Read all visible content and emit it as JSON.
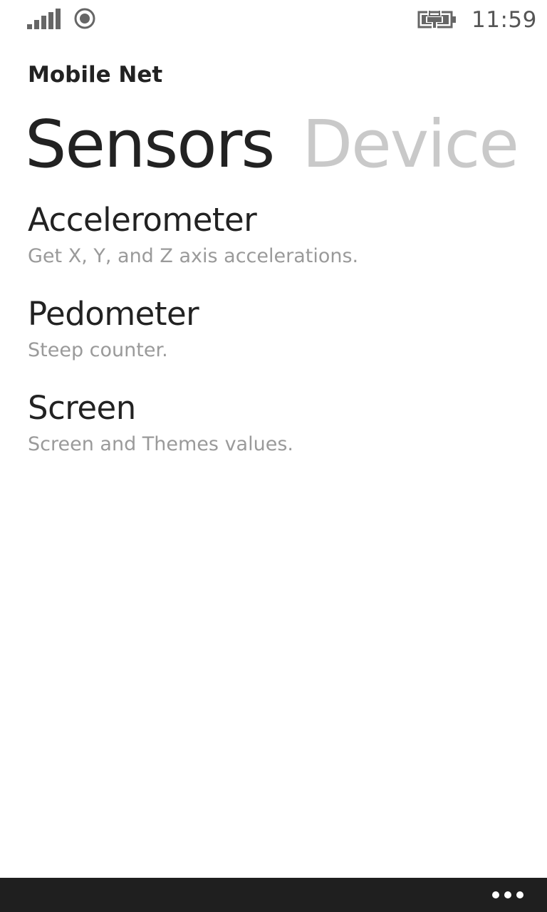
{
  "status_bar": {
    "time": "11:59",
    "signal_icon": "signal-strength-icon",
    "data_icon": "data-connection-icon",
    "battery_icon": "battery-charging-icon"
  },
  "app": {
    "title": "Mobile Net"
  },
  "pivot": {
    "active": "Sensors",
    "next": "Device"
  },
  "list": [
    {
      "title": "Accelerometer",
      "subtitle": "Get X, Y, and Z axis accelerations."
    },
    {
      "title": "Pedometer",
      "subtitle": "Steep counter."
    },
    {
      "title": "Screen",
      "subtitle": "Screen and Themes values."
    }
  ],
  "app_bar": {
    "more_icon": "ellipsis-icon"
  },
  "colors": {
    "text": "#222222",
    "subtext": "#9a9a9a",
    "inactive_pivot": "#c9c9c9",
    "app_bar": "#1f1f1f"
  }
}
